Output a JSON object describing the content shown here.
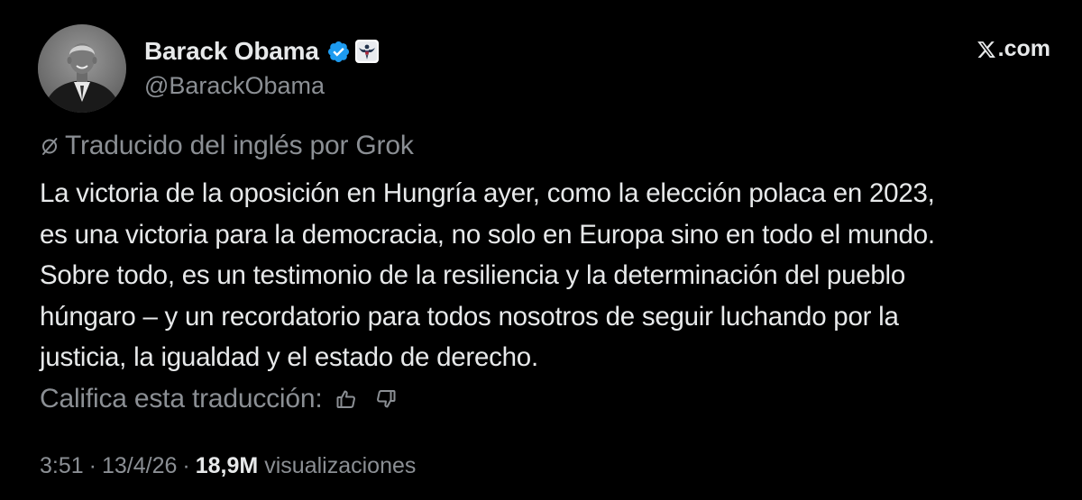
{
  "author": {
    "display_name": "Barack Obama",
    "handle": "@BarackObama",
    "verified": true,
    "verified_color": "#1d9bf0",
    "affiliation_badge": "us-seal-icon",
    "avatar": "avatar-photo"
  },
  "brand": {
    "icon": "x-logo-icon",
    "label": ".com"
  },
  "translation": {
    "icon": "grok-icon",
    "label": "Traducido del inglés por Grok"
  },
  "tweet": {
    "text": "La victoria de la oposición en Hungría ayer, como la elección polaca en 2023,\nes una victoria para la democracia, no solo en Europa sino en todo el mundo.\nSobre todo, es un testimonio de la resiliencia y la determinación del pueblo\nhúngaro – y un recordatorio para todos nosotros de seguir luchando por la\njusticia, la igualdad y el estado de derecho."
  },
  "rating": {
    "label": "Califica esta traducción:",
    "thumbs_up_icon": "thumbs-up-icon",
    "thumbs_down_icon": "thumbs-down-icon"
  },
  "meta": {
    "time": "3:51",
    "separator": "·",
    "date": "13/4/26",
    "views_count": "18,9M",
    "views_label": "visualizaciones"
  },
  "colors": {
    "background": "#000000",
    "primary_text": "#e7e9ea",
    "secondary_text": "#8b8f94",
    "verified_blue": "#1d9bf0"
  }
}
